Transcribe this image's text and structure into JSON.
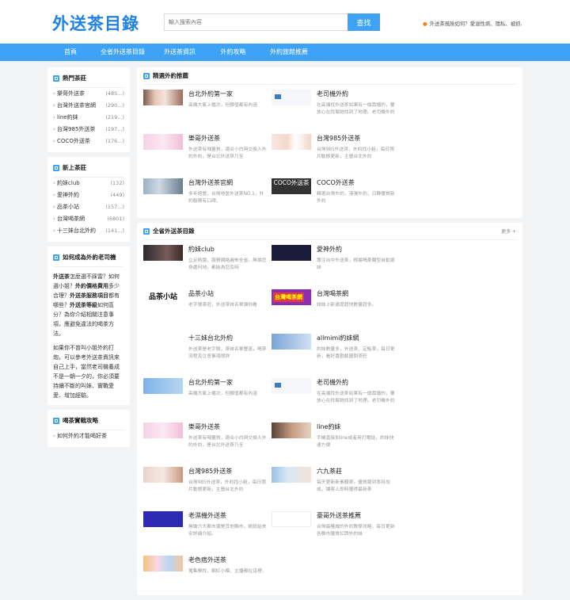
{
  "header": {
    "logo": "外送茶目錄",
    "search_placeholder": "輸入搜索內容",
    "search_button": "查找",
    "hot_link": "外送茶風險如何？愛滋性病、隱私、被抓..."
  },
  "nav": [
    "首頁",
    "全省外送茶目錄",
    "外送茶資訊",
    "外約攻略",
    "外約旅館推薦"
  ],
  "sidebar": {
    "hot_title": "熱門茶莊",
    "hot_items": [
      {
        "name": "樂哥外送茶",
        "count": "(485...)"
      },
      {
        "name": "台灣外送茶官網",
        "count": "(290...)"
      },
      {
        "name": "line約妹",
        "count": "(219...)"
      },
      {
        "name": "台灣985外送茶",
        "count": "(197...)"
      },
      {
        "name": "COCO外送茶",
        "count": "(176...)"
      }
    ],
    "new_title": "新上茶莊",
    "new_items": [
      {
        "name": "約妹club",
        "count": "(132)"
      },
      {
        "name": "愛神外約",
        "count": "(449)"
      },
      {
        "name": "品茶小站",
        "count": "(157...)"
      },
      {
        "name": "台灣喝茶網",
        "count": "(6801)"
      },
      {
        "name": "十三妹台北外約",
        "count": "(141...)"
      }
    ],
    "how_title": "如何成為外約老司機",
    "how_p1_b1": "外送茶",
    "how_p1_t1": "怎麼選不踩雷？如何選小姐？",
    "how_p1_b2": "外約價格費用",
    "how_p1_t2": "多少合理？",
    "how_p1_b3": "外送茶服務項目",
    "how_p1_t3": "都有哪些？",
    "how_p1_b4": "外送茶等級",
    "how_p1_t4": "如何區分？為你介紹相關注意事項，應避免違法的喝茶方法。",
    "how_p2": "如果你不曾叫小姐外約打炮，可以參考外送茶資訊來自己上手，當然老司機養成不是一朝一夕的，你必須要持續不斷的叫妹、實戰愛愛、增加經驗。",
    "tips_title": "喝茶實戰攻略",
    "tips_items": [
      "如何外約才能喝好茶"
    ]
  },
  "featured": {
    "title": "精選外約推薦",
    "items": [
      {
        "title": "台北外約第一家",
        "desc": "高端大氣上檔次，但顏值都有內涵"
      },
      {
        "title": "老司機外約",
        "desc": "在高端找外送茶如果有一個靠譜的，要放心在找幫她找到了地理。老司機外約茶"
      },
      {
        "title": "樂哥外送茶",
        "desc": "外送茶有噸量質，適合小白與交換人外約外約，是台北外送茶乃至"
      },
      {
        "title": "台灣985外送茶",
        "desc": "台灣985外送茶，外約找小姐，每日照片動態更新，主營台北外約"
      },
      {
        "title": "台灣外送茶官網",
        "desc": "多年經營，台灣地區外送茶NO.1，外約服務有口碑。"
      },
      {
        "title": "COCO外送茶",
        "desc": "精選台灣外約，港澳外約，日韓優質新外約"
      }
    ]
  },
  "catalog": {
    "title": "全省外送茶目錄",
    "more": "更多 +",
    "items": [
      {
        "title": "約妹club",
        "desc": "立足桃園，服務網絡遍佈全省，無論您身處何地，都能為您及時"
      },
      {
        "title": "愛神外約",
        "desc": "專注台中外送茶，根據喝茶類型自動選妹"
      },
      {
        "title": "品茶小站",
        "desc": "老字號茶莊，外送茶妹名單讓你看"
      },
      {
        "title": "台灣喝茶網",
        "desc": "妹妹上新速度超快數量超多。"
      },
      {
        "title": "十三妹台北外約",
        "desc": "外送茶是老字號，茶妹名單豐富，喝茶流程及注意事項很詳"
      },
      {
        "title": "allmimi約妹網",
        "desc": "約妹數量多，外送茶、定點茶，每日更新，看好喜歡截圖問茶莊"
      },
      {
        "title": "台北外約第一家",
        "desc": "高端大氣上檔次，但顏值都有內涵"
      },
      {
        "title": "老司機外約",
        "desc": "在高端找外送茶如果有一個靠譜的，要放心在找幫她找到了地理。老司機外約茶"
      },
      {
        "title": "樂哥外送茶",
        "desc": "外送茶有噸量質，適合小白與交換人外約外約，是台北外送茶乃至"
      },
      {
        "title": "line約妹",
        "desc": "手機直接加line或者用打電話，約妹快速方便"
      },
      {
        "title": "台灣985外送茶",
        "desc": "台灣985外送茶，外約找小姐，每日照片動態更新，主營台北外約"
      },
      {
        "title": "六九茶莊",
        "desc": "每天更新新素顏茶，優質報到率持加成，讓客人即時獲得最新茶"
      },
      {
        "title": "老濕機外送茶",
        "desc": "無論六大都市還是其他縣市，統統給夫安詳細介紹。"
      },
      {
        "title": "豪哥外送茶推薦",
        "desc": "台灣最權威的外約教學攻略，每日更新各縣市優質紅牌外約妹"
      },
      {
        "title": "老色痞外送茶",
        "desc": "蒐集樂找，網紅小模、主播都在這裡，"
      }
    ]
  }
}
